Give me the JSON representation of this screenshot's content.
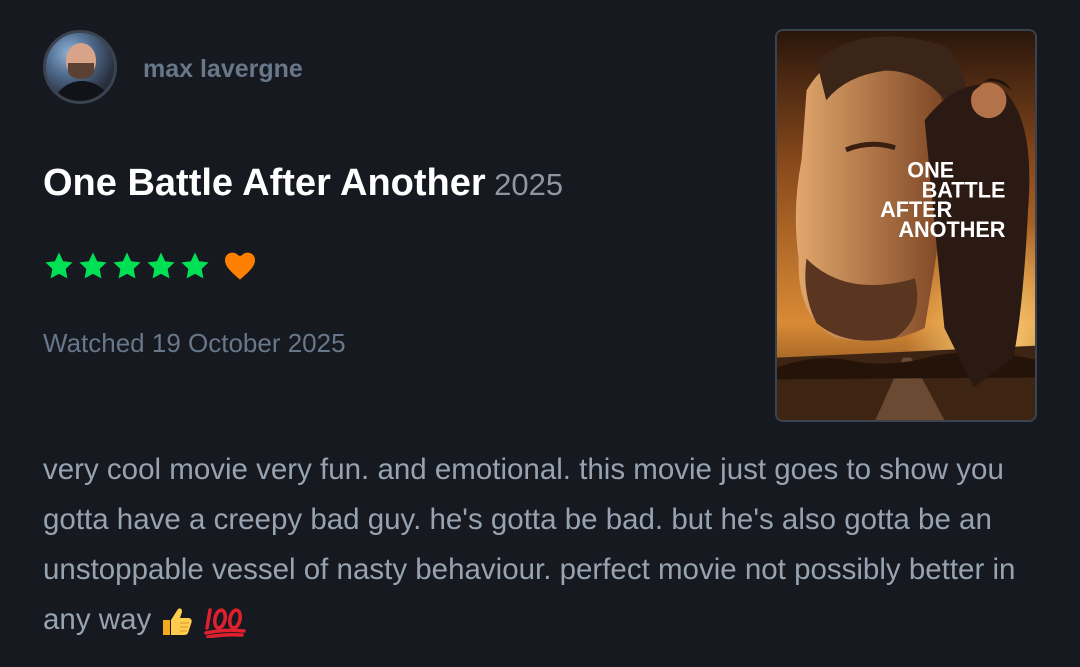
{
  "user": {
    "name": "max lavergne",
    "avatar_icon": "avatar-photo"
  },
  "film": {
    "title": "One Battle After Another",
    "year": "2025",
    "poster_title_lines": [
      "ONE",
      "BATTLE",
      "AFTER",
      "ANOTHER"
    ]
  },
  "rating": {
    "stars": 5,
    "max_stars": 5,
    "star_color": "#00e054",
    "liked": true,
    "heart_color": "#ff8000"
  },
  "watched": {
    "label": "Watched 19 October 2025"
  },
  "review": {
    "text": "very cool movie very fun. and emotional. this movie just goes to show you gotta have a creepy bad guy. he's gotta be bad. but he's also gotta be an unstoppable vessel of nasty behaviour. perfect movie not possibly better in any way",
    "emojis": [
      "thumbs-up-icon",
      "hundred-points-icon"
    ]
  },
  "colors": {
    "background": "#16191f",
    "title": "#ffffff",
    "muted": "#68778a",
    "review_text": "#97a3b0"
  }
}
